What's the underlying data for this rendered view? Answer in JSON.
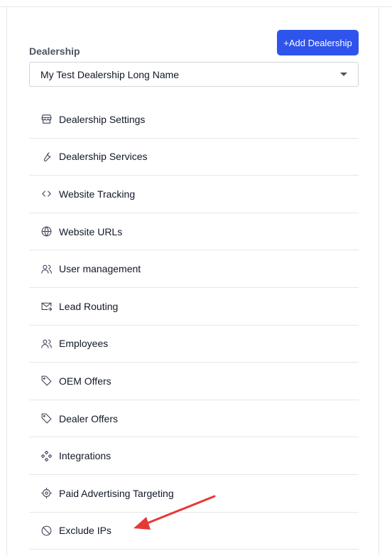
{
  "header": {
    "add_button_label": "+Add Dealership",
    "dealership_label": "Dealership",
    "selected_dealership": "My Test Dealership Long Name"
  },
  "menu": {
    "items": [
      {
        "label": "Dealership Settings",
        "icon": "storefront-icon"
      },
      {
        "label": "Dealership Services",
        "icon": "wrench-icon"
      },
      {
        "label": "Website Tracking",
        "icon": "code-icon"
      },
      {
        "label": "Website URLs",
        "icon": "globe-icon"
      },
      {
        "label": "User management",
        "icon": "users-icon"
      },
      {
        "label": "Lead Routing",
        "icon": "mail-forward-icon"
      },
      {
        "label": "Employees",
        "icon": "users-icon"
      },
      {
        "label": "OEM Offers",
        "icon": "tag-icon"
      },
      {
        "label": "Dealer Offers",
        "icon": "tag-icon"
      },
      {
        "label": "Integrations",
        "icon": "integrations-icon"
      },
      {
        "label": "Paid Advertising Targeting",
        "icon": "target-icon"
      },
      {
        "label": "Exclude IPs",
        "icon": "block-icon"
      }
    ]
  },
  "colors": {
    "primary": "#2f54eb",
    "annotation_arrow": "#e53935"
  }
}
